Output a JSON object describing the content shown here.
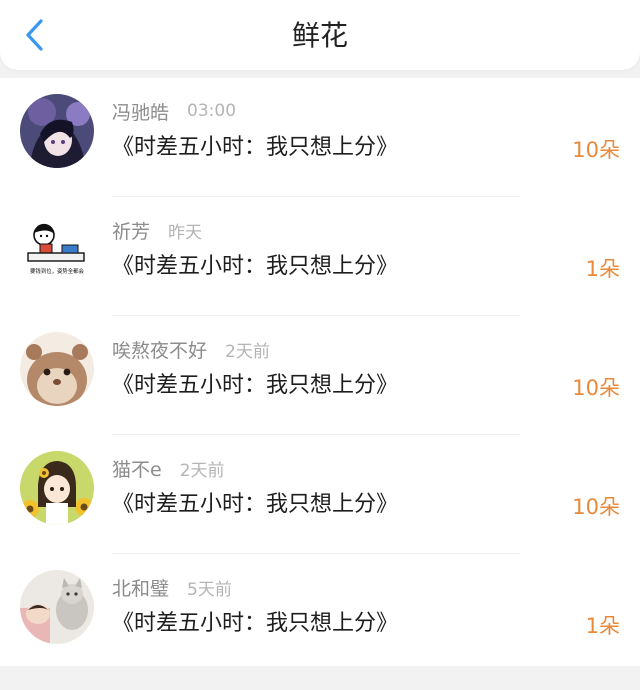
{
  "header": {
    "title": "鲜花",
    "back_icon": "chevron-left-icon",
    "accent": "#3a97f1"
  },
  "colors": {
    "count": "#e8893b",
    "name": "#8c8c8c",
    "time": "#b4b4b4"
  },
  "rows": [
    {
      "name": "冯驰皓",
      "time": "03:00",
      "message": "《时差五小时：我只想上分》",
      "count": "10朵",
      "avatar": "anime-avatar-dark"
    },
    {
      "name": "祈芳",
      "time": "昨天",
      "message": "《时差五小时：我只想上分》",
      "count": "1朵",
      "avatar": "cartoon-avatar-desk",
      "avatar_text": "要钱到位，姿势全都会"
    },
    {
      "name": "唉熬夜不好",
      "time": "2天前",
      "message": "《时差五小时：我只想上分》",
      "count": "10朵",
      "avatar": "hamster-avatar"
    },
    {
      "name": "猫不e",
      "time": "2天前",
      "message": "《时差五小时：我只想上分》",
      "count": "10朵",
      "avatar": "girl-sunflower-avatar"
    },
    {
      "name": "北和璧",
      "time": "5天前",
      "message": "《时差五小时：我只想上分》",
      "count": "1朵",
      "avatar": "cat-photo-avatar"
    }
  ]
}
